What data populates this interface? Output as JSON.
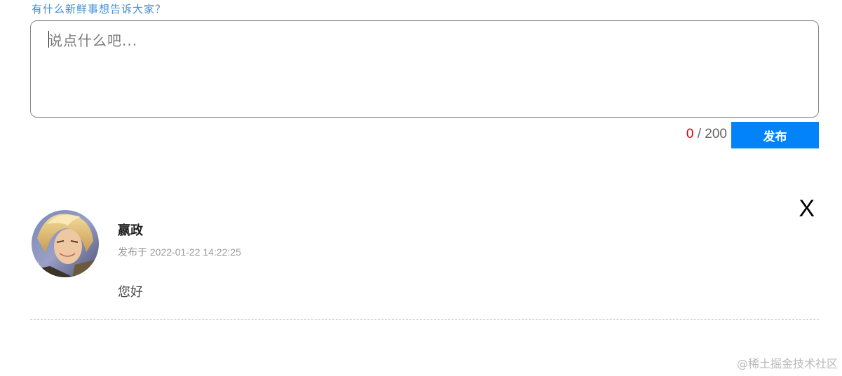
{
  "composer": {
    "title": "有什么新鲜事想告诉大家？",
    "placeholder": "说点什么吧...",
    "value": "",
    "count_current": "0",
    "count_separator": " / ",
    "count_max": "200",
    "publish_label": "发布"
  },
  "comments": [
    {
      "author": "嬴政",
      "time": "发布于 2022-01-22 14:22:25",
      "text": "您好",
      "delete_label": "X"
    }
  ],
  "watermark": "@稀土掘金技术社区",
  "colors": {
    "accent": "#0383f9",
    "counter_current": "#e3000f",
    "title": "#3f8fd6"
  }
}
